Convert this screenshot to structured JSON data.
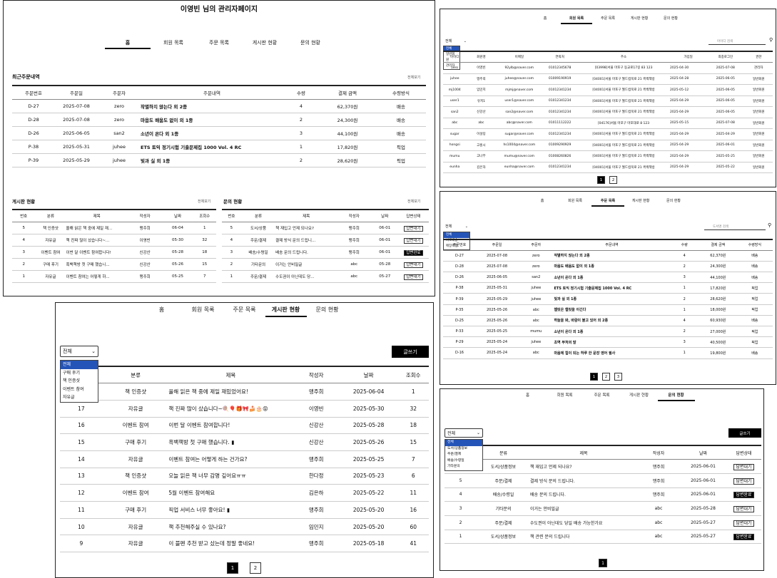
{
  "tabs": [
    "홈",
    "회원 목록",
    "주문 목록",
    "게시판 현황",
    "문의 현황"
  ],
  "p1": {
    "title": "이영빈 님의 관리자페이지",
    "recent": {
      "title": "최근주문내역",
      "more": "전체보기",
      "headers": [
        "주문번호",
        "주문일",
        "주문자",
        "주문내역",
        "수량",
        "결제 금액",
        "수령방식"
      ],
      "rows": [
        [
          "D-27",
          "2025-07-08",
          "zero",
          "작별하지 않는다 외 2종",
          "4",
          "62,370원",
          "배송"
        ],
        [
          "D-28",
          "2025-07-08",
          "zero",
          "마음도 배움도 없이 외 1종",
          "2",
          "24,300원",
          "배송"
        ],
        [
          "D-26",
          "2025-06-05",
          "san2",
          "소년이 온다 외 1종",
          "3",
          "44,100원",
          "배송"
        ],
        [
          "P-38",
          "2025-05-31",
          "juhee",
          "ETS 토익 정기시험 기출문제집 1000 Vol. 4 RC",
          "1",
          "17,820원",
          "픽업"
        ],
        [
          "P-39",
          "2025-05-29",
          "juhee",
          "빛과 실 외 1종",
          "2",
          "28,620원",
          "픽업"
        ]
      ]
    },
    "board": {
      "title": "게시판 현황",
      "more": "전체보기",
      "headers": [
        "번호",
        "분류",
        "제목",
        "작성자",
        "날짜",
        "조회수"
      ],
      "rows": [
        [
          "5",
          "책 인증샷",
          "올해 읽은 책 중에 제일 재...",
          "맹주희",
          "06-04",
          "1"
        ],
        [
          "4",
          "자유글",
          "책 진짜 많이 샀습니다~...",
          "이영빈",
          "05-30",
          "32"
        ],
        [
          "3",
          "이벤트 참여",
          "이번 달 이벤트 참여합니다!",
          "신강산",
          "05-28",
          "18"
        ],
        [
          "2",
          "구매 후기",
          "흑백책방 첫 구매 했습니...",
          "신강산",
          "05-26",
          "15"
        ],
        [
          "1",
          "자유글",
          "이벤트 참여는 어떻게 하...",
          "맹주희",
          "05-25",
          "7"
        ]
      ]
    },
    "inquiry": {
      "title": "문의 현황",
      "more": "전체보기",
      "headers": [
        "번호",
        "분류",
        "제목",
        "작성자",
        "날짜",
        "답변상태"
      ],
      "rows": [
        [
          "5",
          "도서/상품",
          "책 재입고 언제 되나요?",
          "맹주희",
          "06-01",
          "답변대기"
        ],
        [
          "4",
          "주문/결제",
          "결제 방식 문의 드립니...",
          "맹주희",
          "06-01",
          "답변대기"
        ],
        [
          "3",
          "배송/수령일",
          "배송 문의 드립니다.",
          "맹주희",
          "06-01",
          "답변완료"
        ],
        [
          "2",
          "기타문의",
          "이거는 안비밀글",
          "abc",
          "05-28",
          "답변대기"
        ],
        [
          "1",
          "주문/결제",
          "수도권이 아닌데도 당...",
          "abc",
          "05-27",
          "답변대기"
        ]
      ]
    }
  },
  "p2": {
    "select": "전체",
    "options": [
      "전체",
      "일반회원",
      "관리자"
    ],
    "search_placeholder": "아이디 검색",
    "headers": [
      "아이디",
      "회원명",
      "이메일",
      "연락처",
      "주소",
      "가입일",
      "최종로그인",
      "권한"
    ],
    "rows": [
      [
        "13",
        "zero",
        "이영빈",
        "92ylb@naver.com",
        "01012345678",
        "[03998]서울 마포구 동교로17길 83 123",
        "2025-04-30",
        "2025-07-08",
        "관리자"
      ],
      [
        "12",
        "juhee",
        "맹주희",
        "juhee@naver.com",
        "01009190919",
        "[04001]서울 마포구 월드컵북로 21 흑백책방",
        "2025-04-28",
        "2025-06-05",
        "일반회원"
      ],
      [
        "11",
        "mj1004",
        "임민지",
        "mjmj@naver.com",
        "01012341234",
        "[04001]서울 마포구 월드컵북로 21 흑백책방",
        "2025-05-12",
        "2025-06-05",
        "일반회원"
      ],
      [
        "10",
        "user1",
        "유저1",
        "user1@naver.com",
        "01012341234",
        "[04001]서울 마포구 월드컵북로 21 흑백책방",
        "2025-04-29",
        "2025-06-05",
        "일반회원"
      ],
      [
        "9",
        "san2",
        "신강산",
        "san2@naver.com",
        "01012341234",
        "[04001]서울 마포구 월드컵북로 21 흑백책방",
        "2025-04-29",
        "2025-06-05",
        "일반회원"
      ],
      [
        "8",
        "abc",
        "abc",
        "abc@naver.com",
        "01011112222",
        "[04176]서울 마포구 마포대로 8 123",
        "2025-05-15",
        "2025-07-08",
        "일반회원"
      ],
      [
        "7",
        "sugar",
        "이설탕",
        "sugar@naver.com",
        "01012341234",
        "[04001]서울 마포구 월드컵북로 21 흑백책방",
        "2025-04-29",
        "2025-04-29",
        "일반회원"
      ],
      [
        "6",
        "hongsi",
        "고홍시",
        "hs1004@naver.com",
        "01009290929",
        "[04001]서울 마포구 월드컵북로 21 흑백책방",
        "2025-04-29",
        "2025-06-01",
        "일반회원"
      ],
      [
        "5",
        "mumu",
        "고나무",
        "mumu@naver.com",
        "01008260826",
        "[04001]서울 마포구 월드컵북로 21 흑백책방",
        "2025-04-29",
        "2025-05-25",
        "일반회원"
      ],
      [
        "4",
        "eunha",
        "김은하",
        "eunha@naver.com",
        "01012341234",
        "[04001]서울 마포구 월드컵북로 21 흑백책방",
        "2025-04-29",
        "2025-05-22",
        "일반회원"
      ]
    ],
    "pages": [
      "1",
      "2"
    ]
  },
  "p3": {
    "select": "전체",
    "options": [
      "전체",
      "바로배송",
      "매장픽업"
    ],
    "search_placeholder": "도서명 검색",
    "headers": [
      "주문번호",
      "주문일",
      "주문자",
      "주문내역",
      "수량",
      "결제 금액",
      "수령방식"
    ],
    "rows": [
      [
        "D-27",
        "2025-07-08",
        "zero",
        "작별하지 않는다 외 2종",
        "4",
        "62,370원",
        "배송"
      ],
      [
        "D-28",
        "2025-07-08",
        "zero",
        "마음도 배움도 없이 외 1종",
        "2",
        "24,300원",
        "배송"
      ],
      [
        "D-26",
        "2025-06-05",
        "san2",
        "소년이 온다 외 1종",
        "3",
        "44,100원",
        "배송"
      ],
      [
        "P-38",
        "2025-05-31",
        "juhee",
        "ETS 토익 정기시험 기출문제집 1000 Vol. 4 RC",
        "1",
        "17,820원",
        "픽업"
      ],
      [
        "P-39",
        "2025-05-29",
        "juhee",
        "빛과 실 외 1종",
        "2",
        "28,620원",
        "픽업"
      ],
      [
        "P-35",
        "2025-05-26",
        "abc",
        "햄릿은 햄릿을 이긴다",
        "1",
        "18,000원",
        "픽업"
      ],
      [
        "D-25",
        "2025-05-26",
        "abc",
        "하늘을 봐, 바람이 불고 있어 외 2종",
        "4",
        "60,930원",
        "배송"
      ],
      [
        "P-33",
        "2025-05-25",
        "mumu",
        "소년이 온다 외 1종",
        "2",
        "27,000원",
        "픽업"
      ],
      [
        "P-29",
        "2025-05-24",
        "juhee",
        "초역 부처의 말",
        "3",
        "40,500원",
        "픽업"
      ],
      [
        "D-16",
        "2025-05-24",
        "abc",
        "마음에 힘이 되는 하루 한 문장 영어 필사",
        "1",
        "19,800원",
        "배송"
      ]
    ],
    "pages": [
      "1",
      "2",
      "3"
    ]
  },
  "p4": {
    "select": "전체",
    "options": [
      "전체",
      "구매 후기",
      "책 인증샷",
      "이벤트 참여",
      "자유글"
    ],
    "write": "글쓰기",
    "headers": [
      "번호",
      "분류",
      "제목",
      "작성자",
      "날짜",
      "조회수"
    ],
    "rows": [
      [
        "18",
        "책 인증샷",
        "올해 읽은 책 중에 제일 재밌었어요!",
        "맹주희",
        "2025-06-04",
        "1"
      ],
      [
        "17",
        "자유글",
        "책 진짜 많이 샀습니다~🍭🎈🎁🎀🍰🎂😝",
        "이영빈",
        "2025-05-30",
        "32"
      ],
      [
        "16",
        "이벤트 참여",
        "이번 달 이벤트 참여합니다!",
        "신강산",
        "2025-05-28",
        "18"
      ],
      [
        "15",
        "구매 후기",
        "흑백책방 첫 구매 했습니다. ▮",
        "신강산",
        "2025-05-26",
        "15"
      ],
      [
        "14",
        "자유글",
        "이벤트 참여는 어떻게 하는 건가요?",
        "맹주희",
        "2025-05-25",
        "7"
      ],
      [
        "13",
        "책 인증샷",
        "오늘 읽은 책 너무 감명 깊어요ㅠㅠ",
        "한다정",
        "2025-05-23",
        "6"
      ],
      [
        "12",
        "이벤트 참여",
        "5월 이벤트 참여해요",
        "김은하",
        "2025-05-22",
        "11"
      ],
      [
        "11",
        "구매 후기",
        "픽업 서비스 너무 좋아요! ▮",
        "맹주희",
        "2025-05-20",
        "16"
      ],
      [
        "10",
        "자유글",
        "책 추천해주실 수 있나요?",
        "임민지",
        "2025-05-20",
        "60"
      ],
      [
        "9",
        "자유글",
        "이 블펜 추천 받고 샀는데 정말 좋네요!",
        "맹주희",
        "2025-05-18",
        "41"
      ]
    ],
    "pages": [
      "1",
      "2"
    ]
  },
  "p5": {
    "select": "전체",
    "options": [
      "전체",
      "도서/상품정보",
      "주문/결제",
      "배송/수령일",
      "기타문의"
    ],
    "write": "글쓰기",
    "headers": [
      "번호",
      "분류",
      "제목",
      "작성자",
      "날짜",
      "답변상태"
    ],
    "rows": [
      [
        "6",
        "도서/상품정보",
        "책 재입고 언제 되나요?",
        "맹주희",
        "2025-06-01",
        "답변대기"
      ],
      [
        "5",
        "주문/결제",
        "결제 방식 문의 드립니다.",
        "맹주희",
        "2025-06-01",
        "답변대기"
      ],
      [
        "4",
        "배송/수령일",
        "배송 문의 드립니다.",
        "맹주희",
        "2025-06-01",
        "답변완료"
      ],
      [
        "3",
        "기타문의",
        "이거는 안비밀글",
        "abc",
        "2025-05-28",
        "답변대기"
      ],
      [
        "2",
        "주문/결제",
        "수도권이 아닌데도 당일 배송 가능한가요",
        "abc",
        "2025-05-27",
        "답변대기"
      ],
      [
        "1",
        "도서/상품정보",
        "책 관련 문의 드립니다",
        "abc",
        "2025-05-27",
        "답변완료"
      ]
    ],
    "pages": [
      "1"
    ]
  }
}
